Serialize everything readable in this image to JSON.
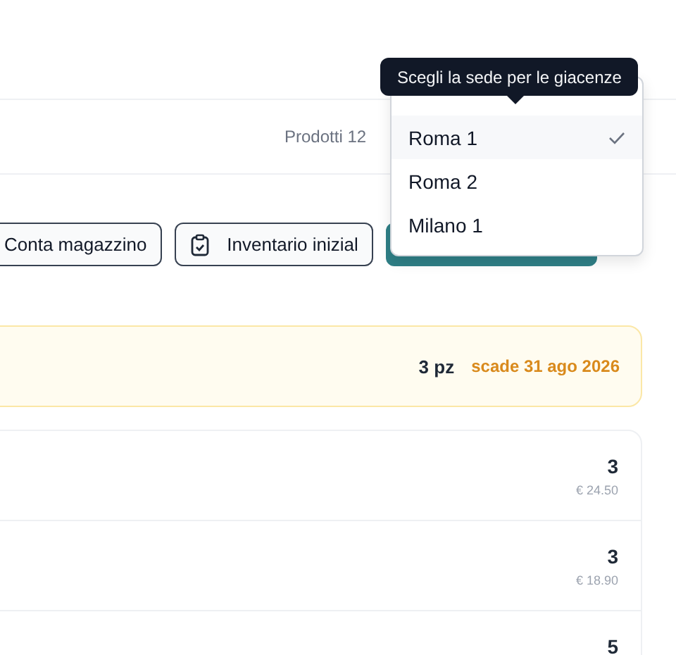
{
  "summary": {
    "products": "Prodotti 12"
  },
  "actions": [
    {
      "kind": "outline",
      "label": "Conta magazzino"
    },
    {
      "kind": "outline_icon",
      "label": "Inventario inizial"
    },
    {
      "kind": "primary"
    }
  ],
  "alert": {
    "quantity": "3 pz",
    "expiry": "scade 31 ago 2026"
  },
  "rows": [
    {
      "quantity": "3",
      "price": "€ 24.50"
    },
    {
      "quantity": "3",
      "price": "€ 18.90"
    },
    {
      "quantity": "5"
    }
  ],
  "location_menu": {
    "tooltip": "Scegli la sede per le giacenze",
    "options": [
      {
        "label": "Roma 1",
        "selected": true
      },
      {
        "label": "Roma 2",
        "selected": false
      },
      {
        "label": "Milano 1",
        "selected": false
      }
    ]
  }
}
